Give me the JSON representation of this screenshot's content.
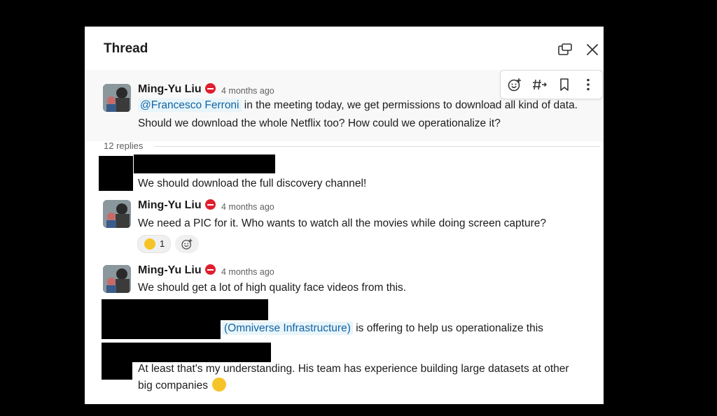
{
  "thread": {
    "title": "Thread",
    "icons": [
      "pop-out-icon",
      "close-icon"
    ]
  },
  "parent_message": {
    "author": "Ming-Yu Liu",
    "timestamp": "4 months ago",
    "mention": "@Francesco Ferroni",
    "line1_rest": " in the meeting today, we get permissions to download all kind of data.",
    "line2": "Should we download the whole Netflix too? How could we operationalize it?",
    "toolbar_icons": [
      "add-reaction-icon",
      "reply-in-channel-icon",
      "bookmark-icon",
      "more-actions-icon"
    ]
  },
  "replies_label": "12 replies",
  "replies": [
    {
      "author": "",
      "author_redacted": true,
      "text": "We should download the full discovery channel!"
    },
    {
      "author": "Ming-Yu Liu",
      "timestamp": "4 months ago",
      "text": "We need a PIC for it. Who wants to watch all the movies while doing screen capture?",
      "reaction": {
        "emoji": "laughing-face",
        "count": "1"
      }
    },
    {
      "author": "Ming-Yu Liu",
      "timestamp": "4 months ago",
      "text": "We should get a lot of high quality face videos from this."
    },
    {
      "author": "",
      "author_redacted": true,
      "mention": "(Omniverse Infrastructure)",
      "text_rest": " is offering to help us operationalize this"
    },
    {
      "author": "",
      "author_redacted": true,
      "line1": "At least that's my understanding. His team has experience building large datasets at other",
      "line2": "big companies",
      "emoji": "slightly-smiling-face"
    }
  ]
}
